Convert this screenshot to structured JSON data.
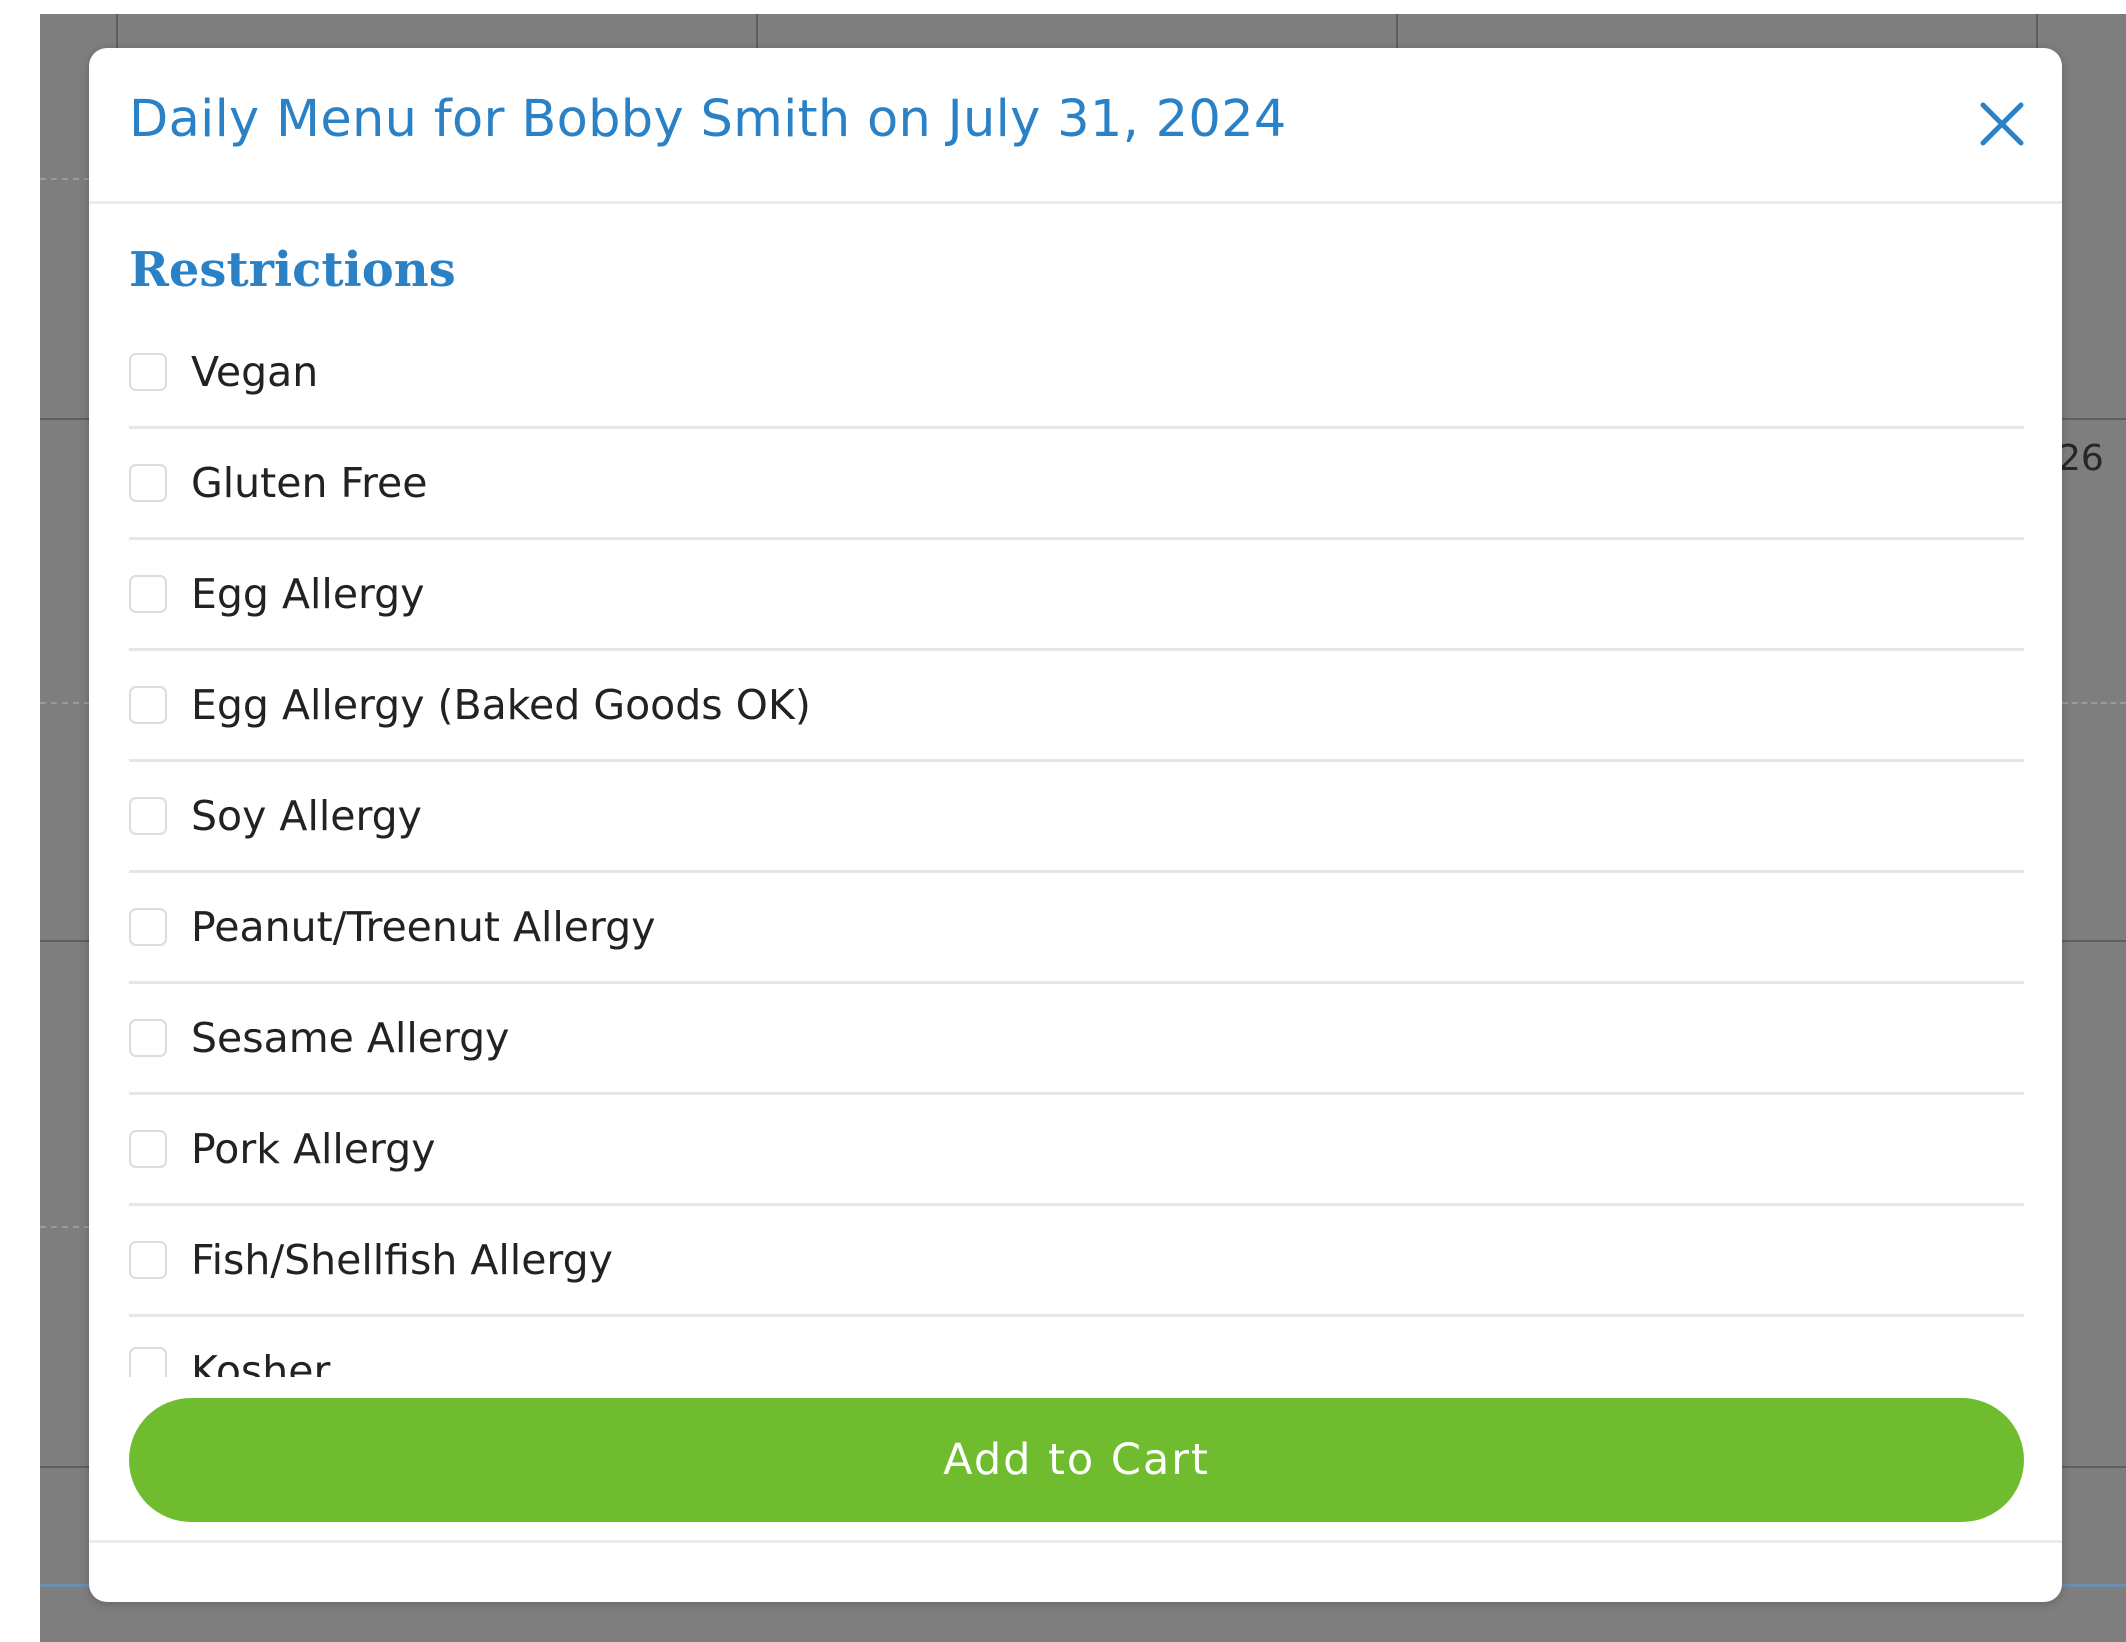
{
  "modal": {
    "title": "Daily Menu for Bobby Smith on July 31, 2024",
    "close_icon": "close-icon",
    "section_heading": "Restrictions",
    "restrictions": [
      {
        "label": "Vegan",
        "checked": false
      },
      {
        "label": "Gluten Free",
        "checked": false
      },
      {
        "label": "Egg Allergy",
        "checked": false
      },
      {
        "label": "Egg Allergy (Baked Goods OK)",
        "checked": false
      },
      {
        "label": "Soy Allergy",
        "checked": false
      },
      {
        "label": "Peanut/Treenut Allergy",
        "checked": false
      },
      {
        "label": "Sesame Allergy",
        "checked": false
      },
      {
        "label": "Pork Allergy",
        "checked": false
      },
      {
        "label": "Fish/Shellfish Allergy",
        "checked": false
      },
      {
        "label": "Kosher",
        "checked": false
      }
    ],
    "add_to_cart_label": "Add to Cart"
  },
  "background": {
    "fragment_text": "26"
  },
  "colors": {
    "accent_blue": "#2a81c6",
    "button_green": "#6fbd2f",
    "overlay_gray": "#7e7e7e"
  }
}
